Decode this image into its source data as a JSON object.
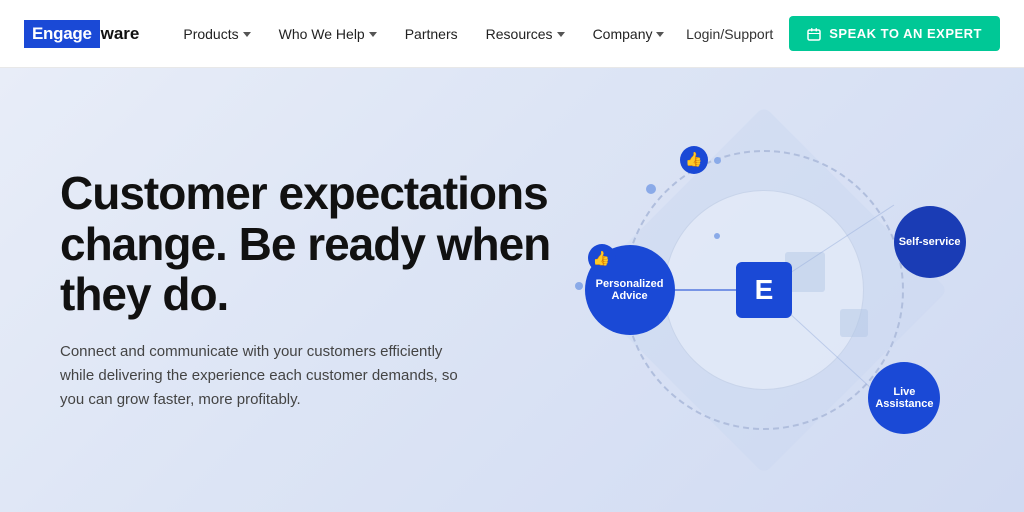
{
  "brand": {
    "engage": "Engage",
    "ware": "ware"
  },
  "navbar": {
    "links": [
      {
        "label": "Products",
        "has_dropdown": true
      },
      {
        "label": "Who We Help",
        "has_dropdown": true
      },
      {
        "label": "Partners",
        "has_dropdown": false
      },
      {
        "label": "Resources",
        "has_dropdown": true
      },
      {
        "label": "Company",
        "has_dropdown": true
      }
    ],
    "login_label": "Login/Support",
    "cta_label": "SPEAK TO AN EXPERT"
  },
  "hero": {
    "heading": "Customer expectations change. Be ready when they do.",
    "subtext": "Connect and communicate with your customers efficiently while delivering the experience each customer demands, so you can grow faster, more profitably.",
    "diagram": {
      "center_letter": "E",
      "node_personalized": "Personalized Advice",
      "node_self_service": "Self-service",
      "node_live": "Live Assistance"
    }
  }
}
